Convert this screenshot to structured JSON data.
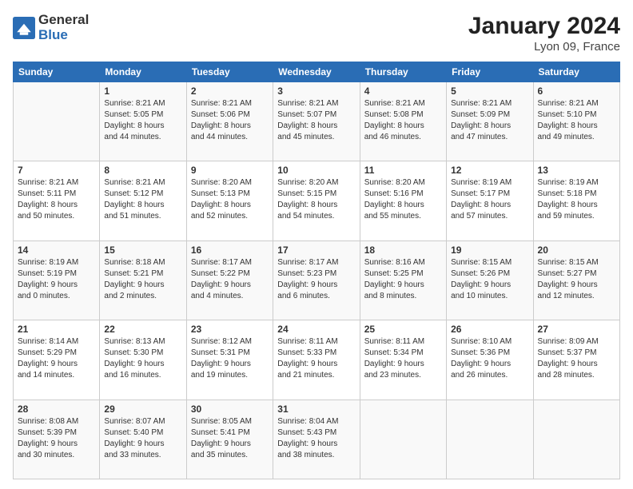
{
  "header": {
    "logo_general": "General",
    "logo_blue": "Blue",
    "month_year": "January 2024",
    "location": "Lyon 09, France"
  },
  "days_of_week": [
    "Sunday",
    "Monday",
    "Tuesday",
    "Wednesday",
    "Thursday",
    "Friday",
    "Saturday"
  ],
  "weeks": [
    [
      {
        "day": "",
        "info": ""
      },
      {
        "day": "1",
        "info": "Sunrise: 8:21 AM\nSunset: 5:05 PM\nDaylight: 8 hours\nand 44 minutes."
      },
      {
        "day": "2",
        "info": "Sunrise: 8:21 AM\nSunset: 5:06 PM\nDaylight: 8 hours\nand 44 minutes."
      },
      {
        "day": "3",
        "info": "Sunrise: 8:21 AM\nSunset: 5:07 PM\nDaylight: 8 hours\nand 45 minutes."
      },
      {
        "day": "4",
        "info": "Sunrise: 8:21 AM\nSunset: 5:08 PM\nDaylight: 8 hours\nand 46 minutes."
      },
      {
        "day": "5",
        "info": "Sunrise: 8:21 AM\nSunset: 5:09 PM\nDaylight: 8 hours\nand 47 minutes."
      },
      {
        "day": "6",
        "info": "Sunrise: 8:21 AM\nSunset: 5:10 PM\nDaylight: 8 hours\nand 49 minutes."
      }
    ],
    [
      {
        "day": "7",
        "info": "Sunrise: 8:21 AM\nSunset: 5:11 PM\nDaylight: 8 hours\nand 50 minutes."
      },
      {
        "day": "8",
        "info": "Sunrise: 8:21 AM\nSunset: 5:12 PM\nDaylight: 8 hours\nand 51 minutes."
      },
      {
        "day": "9",
        "info": "Sunrise: 8:20 AM\nSunset: 5:13 PM\nDaylight: 8 hours\nand 52 minutes."
      },
      {
        "day": "10",
        "info": "Sunrise: 8:20 AM\nSunset: 5:15 PM\nDaylight: 8 hours\nand 54 minutes."
      },
      {
        "day": "11",
        "info": "Sunrise: 8:20 AM\nSunset: 5:16 PM\nDaylight: 8 hours\nand 55 minutes."
      },
      {
        "day": "12",
        "info": "Sunrise: 8:19 AM\nSunset: 5:17 PM\nDaylight: 8 hours\nand 57 minutes."
      },
      {
        "day": "13",
        "info": "Sunrise: 8:19 AM\nSunset: 5:18 PM\nDaylight: 8 hours\nand 59 minutes."
      }
    ],
    [
      {
        "day": "14",
        "info": "Sunrise: 8:19 AM\nSunset: 5:19 PM\nDaylight: 9 hours\nand 0 minutes."
      },
      {
        "day": "15",
        "info": "Sunrise: 8:18 AM\nSunset: 5:21 PM\nDaylight: 9 hours\nand 2 minutes."
      },
      {
        "day": "16",
        "info": "Sunrise: 8:17 AM\nSunset: 5:22 PM\nDaylight: 9 hours\nand 4 minutes."
      },
      {
        "day": "17",
        "info": "Sunrise: 8:17 AM\nSunset: 5:23 PM\nDaylight: 9 hours\nand 6 minutes."
      },
      {
        "day": "18",
        "info": "Sunrise: 8:16 AM\nSunset: 5:25 PM\nDaylight: 9 hours\nand 8 minutes."
      },
      {
        "day": "19",
        "info": "Sunrise: 8:15 AM\nSunset: 5:26 PM\nDaylight: 9 hours\nand 10 minutes."
      },
      {
        "day": "20",
        "info": "Sunrise: 8:15 AM\nSunset: 5:27 PM\nDaylight: 9 hours\nand 12 minutes."
      }
    ],
    [
      {
        "day": "21",
        "info": "Sunrise: 8:14 AM\nSunset: 5:29 PM\nDaylight: 9 hours\nand 14 minutes."
      },
      {
        "day": "22",
        "info": "Sunrise: 8:13 AM\nSunset: 5:30 PM\nDaylight: 9 hours\nand 16 minutes."
      },
      {
        "day": "23",
        "info": "Sunrise: 8:12 AM\nSunset: 5:31 PM\nDaylight: 9 hours\nand 19 minutes."
      },
      {
        "day": "24",
        "info": "Sunrise: 8:11 AM\nSunset: 5:33 PM\nDaylight: 9 hours\nand 21 minutes."
      },
      {
        "day": "25",
        "info": "Sunrise: 8:11 AM\nSunset: 5:34 PM\nDaylight: 9 hours\nand 23 minutes."
      },
      {
        "day": "26",
        "info": "Sunrise: 8:10 AM\nSunset: 5:36 PM\nDaylight: 9 hours\nand 26 minutes."
      },
      {
        "day": "27",
        "info": "Sunrise: 8:09 AM\nSunset: 5:37 PM\nDaylight: 9 hours\nand 28 minutes."
      }
    ],
    [
      {
        "day": "28",
        "info": "Sunrise: 8:08 AM\nSunset: 5:39 PM\nDaylight: 9 hours\nand 30 minutes."
      },
      {
        "day": "29",
        "info": "Sunrise: 8:07 AM\nSunset: 5:40 PM\nDaylight: 9 hours\nand 33 minutes."
      },
      {
        "day": "30",
        "info": "Sunrise: 8:05 AM\nSunset: 5:41 PM\nDaylight: 9 hours\nand 35 minutes."
      },
      {
        "day": "31",
        "info": "Sunrise: 8:04 AM\nSunset: 5:43 PM\nDaylight: 9 hours\nand 38 minutes."
      },
      {
        "day": "",
        "info": ""
      },
      {
        "day": "",
        "info": ""
      },
      {
        "day": "",
        "info": ""
      }
    ]
  ]
}
